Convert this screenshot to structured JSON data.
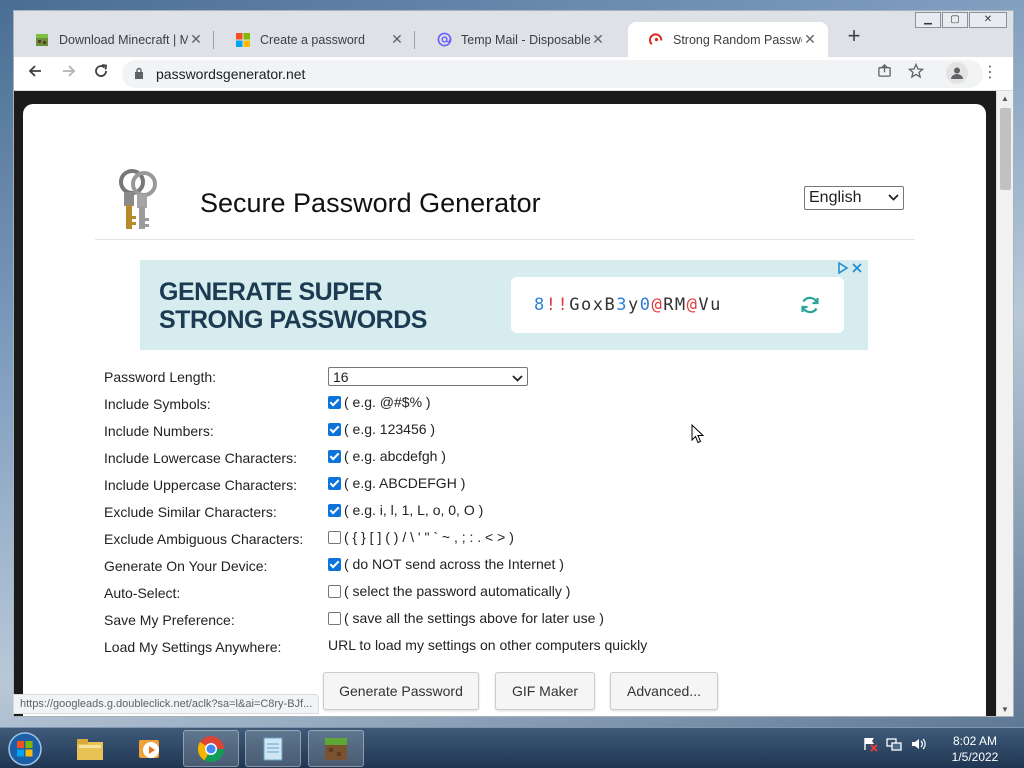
{
  "browser": {
    "tabs": [
      {
        "title": "Download Minecraft | Minecraft",
        "icon": "minecraft-icon",
        "close": "✕"
      },
      {
        "title": "Create a password",
        "icon": "microsoft-icon",
        "close": "✕"
      },
      {
        "title": "Temp Mail - Disposable Temporary Email",
        "icon": "tempmail-icon",
        "close": "✕"
      },
      {
        "title": "Strong Random Password Generator",
        "icon": "passwordsgenerator-icon",
        "close": "✕"
      }
    ],
    "new_tab": "+",
    "url": "passwordsgenerator.net",
    "status_url": "https://googleads.g.doubleclick.net/aclk?sa=l&ai=C8ry-BJf..."
  },
  "page": {
    "title": "Secure Password Generator",
    "language": "English",
    "ad": {
      "headline_line1": "GENERATE SUPER",
      "headline_line2": "STRONG PASSWORDS",
      "sample_password_parts": [
        {
          "text": "8",
          "color": "#2f7fd9"
        },
        {
          "text": "!!",
          "color": "#e03b3b"
        },
        {
          "text": "GoxB",
          "color": "#333333"
        },
        {
          "text": "3",
          "color": "#2f7fd9"
        },
        {
          "text": "y",
          "color": "#333333"
        },
        {
          "text": "0",
          "color": "#2f7fd9"
        },
        {
          "text": "@",
          "color": "#e03b3b"
        },
        {
          "text": "RM",
          "color": "#333333"
        },
        {
          "text": "@",
          "color": "#e03b3b"
        },
        {
          "text": "Vu",
          "color": "#333333"
        }
      ]
    },
    "settings": [
      {
        "label": "Password Length:",
        "type": "select",
        "value": "16"
      },
      {
        "label": "Include Symbols:",
        "type": "checkbox",
        "checked": true,
        "hint": "( e.g. @#$% )"
      },
      {
        "label": "Include Numbers:",
        "type": "checkbox",
        "checked": true,
        "hint": "( e.g. 123456 )"
      },
      {
        "label": "Include Lowercase Characters:",
        "type": "checkbox",
        "checked": true,
        "hint": "( e.g. abcdefgh )"
      },
      {
        "label": "Include Uppercase Characters:",
        "type": "checkbox",
        "checked": true,
        "hint": "( e.g. ABCDEFGH )"
      },
      {
        "label": "Exclude Similar Characters:",
        "type": "checkbox",
        "checked": true,
        "hint": "( e.g. i, l, 1, L, o, 0, O )"
      },
      {
        "label": "Exclude Ambiguous Characters:",
        "type": "checkbox",
        "checked": false,
        "hint": "( { } [ ] ( ) / \\ ' \" ` ~ , ; : . < > )"
      },
      {
        "label": "Generate On Your Device:",
        "type": "checkbox",
        "checked": true,
        "hint": "( do NOT send across the Internet )"
      },
      {
        "label": "Auto-Select:",
        "type": "checkbox",
        "checked": false,
        "hint": "( select the password automatically )"
      },
      {
        "label": "Save My Preference:",
        "type": "checkbox",
        "checked": false,
        "hint": "( save all the settings above for later use )"
      },
      {
        "label": "Load My Settings Anywhere:",
        "type": "text",
        "hint": "URL to load my settings on other computers quickly"
      }
    ],
    "buttons": {
      "generate": "Generate Password",
      "gif": "GIF Maker",
      "advanced": "Advanced..."
    }
  },
  "taskbar": {
    "time": "8:02 AM",
    "date": "1/5/2022"
  },
  "colors": {
    "checkbox_on": "#0b73d9",
    "ad_background": "#d6ecef",
    "ad_headline": "#1c3b53"
  }
}
